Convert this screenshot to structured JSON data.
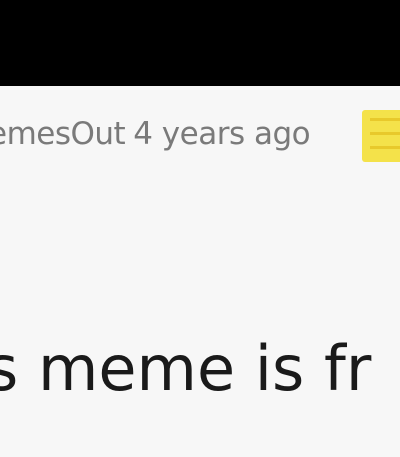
{
  "comment": {
    "username": "emesOut",
    "timestamp": "4 years ago",
    "text_line_1": "s meme is fr",
    "text_line_2": ""
  },
  "colors": {
    "background_top": "#000000",
    "card_background": "#f7f7f7",
    "meta_text": "#7a7a7a",
    "body_text": "#1a1a1a",
    "badge": "#f4e24a"
  }
}
